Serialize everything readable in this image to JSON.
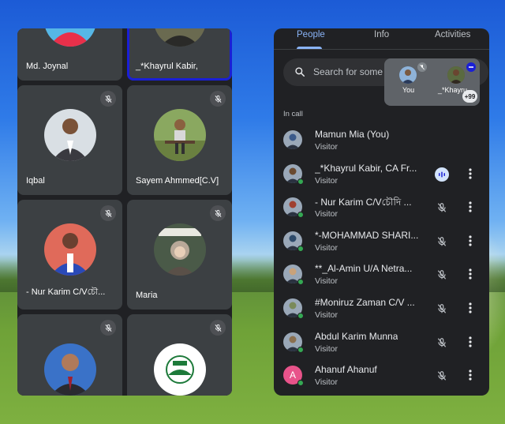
{
  "colors": {
    "accent": "#8ab4f8",
    "panel": "#202124",
    "tile": "#3c4043",
    "active_outline": "#1a1fd6",
    "online_dot": "#34a853"
  },
  "grid": {
    "tiles": [
      {
        "name": "Md. Joynal",
        "muted": false,
        "active": false,
        "icon": "avatar-red-shirt"
      },
      {
        "name": "_*Khayrul Kabir,",
        "muted": false,
        "active": true,
        "icon": "avatar-man"
      },
      {
        "name": "Iqbal",
        "muted": true,
        "active": false,
        "icon": "avatar-man-suit"
      },
      {
        "name": "Sayem Ahmmed[C.V]",
        "muted": true,
        "active": false,
        "icon": "avatar-man-bench"
      },
      {
        "name": "- Nur Karim C/Vচৌ...",
        "muted": true,
        "active": false,
        "icon": "avatar-man-blue"
      },
      {
        "name": "Maria",
        "muted": true,
        "active": false,
        "icon": "avatar-hijab"
      },
      {
        "name": "",
        "muted": true,
        "active": false,
        "icon": "avatar-man-tie"
      },
      {
        "name": "",
        "muted": true,
        "active": false,
        "icon": "avatar-logo"
      }
    ]
  },
  "people_panel": {
    "tabs": [
      {
        "label": "People",
        "selected": true
      },
      {
        "label": "Info",
        "selected": false
      },
      {
        "label": "Activities",
        "selected": false
      }
    ],
    "search": {
      "placeholder": "Search for some",
      "icon": "search-icon"
    },
    "overlay": {
      "you_label": "You",
      "other_label": "_*Khayru",
      "more_count": "+99"
    },
    "section_label": "In call",
    "people": [
      {
        "name": "Mamun Mia (You)",
        "role": "Visitor",
        "status": "none",
        "more": false,
        "avatar_color": "#3b5a8a"
      },
      {
        "name": "_*Khayrul Kabir, CA Fr...",
        "role": "Visitor",
        "status": "speaking",
        "more": true,
        "avatar_color": "#6a4a30"
      },
      {
        "name": "- Nur Karim C/Vচৌদি ...",
        "role": "Visitor",
        "status": "muted",
        "more": true,
        "avatar_color": "#a04030"
      },
      {
        "name": "*-MOHAMMAD SHARI...",
        "role": "Visitor",
        "status": "muted",
        "more": true,
        "avatar_color": "#2d4a6a"
      },
      {
        "name": "**_Al-Amin U/A Netra...",
        "role": "Visitor",
        "status": "muted",
        "more": true,
        "avatar_color": "#c9a27a"
      },
      {
        "name": "#Moniruz Zaman C/V ...",
        "role": "Visitor",
        "status": "muted",
        "more": true,
        "avatar_color": "#7a8a5a"
      },
      {
        "name": "Abdul Karim Munna",
        "role": "Visitor",
        "status": "muted",
        "more": true,
        "avatar_color": "#8a7050"
      },
      {
        "name": "Ahanuf Ahanuf",
        "role": "Visitor",
        "status": "muted",
        "more": true,
        "avatar_color": "#e8538a",
        "initial": "A"
      }
    ]
  }
}
